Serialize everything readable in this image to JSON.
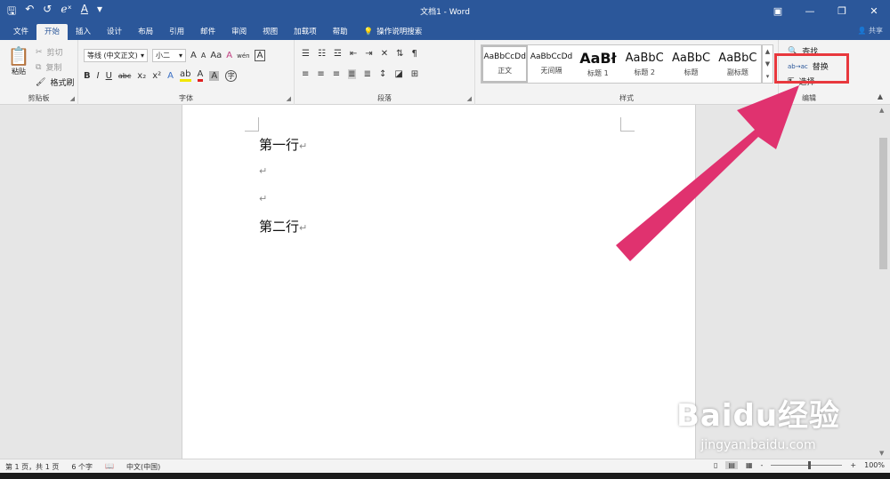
{
  "titlebar": {
    "title": "文档1 - Word",
    "qat": {
      "save": "🖫",
      "undo": "↶",
      "redo": "↺",
      "equation": "ℯˣ",
      "font_color": "A",
      "customize": "▾"
    },
    "controls": {
      "ribbon_display": "▣",
      "minimize": "—",
      "restore": "❐",
      "close": "✕"
    }
  },
  "tabs": [
    {
      "label": "文件"
    },
    {
      "label": "开始"
    },
    {
      "label": "插入"
    },
    {
      "label": "设计"
    },
    {
      "label": "布局"
    },
    {
      "label": "引用"
    },
    {
      "label": "邮件"
    },
    {
      "label": "审阅"
    },
    {
      "label": "视图"
    },
    {
      "label": "加载项"
    },
    {
      "label": "帮助"
    }
  ],
  "tellme": {
    "icon": "lightbulb-icon",
    "label": "操作说明搜索"
  },
  "share": "共享",
  "ribbon": {
    "clipboard": {
      "label": "剪贴板",
      "paste": "粘贴",
      "cut": "剪切",
      "copy": "复制",
      "format_painter": "格式刷"
    },
    "font": {
      "label": "字体",
      "font_name": "等线 (中文正文)",
      "font_size": "小二",
      "grow": "A",
      "shrink": "A",
      "case": "Aa",
      "clear": "A",
      "phonetic": "wén",
      "border": "A",
      "bold": "B",
      "italic": "I",
      "underline": "U",
      "strike": "abc",
      "subscript": "x₂",
      "superscript": "x²",
      "effects": "A",
      "highlight": "ab",
      "color": "A",
      "shading": "A",
      "enclose": "字"
    },
    "paragraph": {
      "label": "段落"
    },
    "styles": {
      "label": "样式",
      "items": [
        {
          "preview": "AaBbCcDd",
          "name": "正文",
          "selected": true
        },
        {
          "preview": "AaBbCcDd",
          "name": "无间隔"
        },
        {
          "preview": "AaBł",
          "name": "标题 1"
        },
        {
          "preview": "AaBbC",
          "name": "标题 2"
        },
        {
          "preview": "AaBbC",
          "name": "标题"
        },
        {
          "preview": "AaBbC",
          "name": "副标题"
        }
      ]
    },
    "editing": {
      "label": "编辑",
      "find": "查找",
      "replace": "替换",
      "select": "选择"
    }
  },
  "document": {
    "paragraphs": [
      "第一行",
      "",
      "",
      "第二行"
    ],
    "paragraph_mark": "↵"
  },
  "status": {
    "page": "第 1 页，共 1 页",
    "words": "6 个字",
    "language": "中文(中国)",
    "zoom": "100%",
    "zoom_minus": "-",
    "zoom_plus": "+"
  },
  "annotation": {
    "box_color": "#e8383d",
    "arrow_color": "#e0326f"
  },
  "watermark": {
    "brand": "Baidu经验",
    "url": "jingyan.baidu.com"
  },
  "colors": {
    "brand": "#2b579a",
    "ribbon": "#f3f3f3"
  }
}
